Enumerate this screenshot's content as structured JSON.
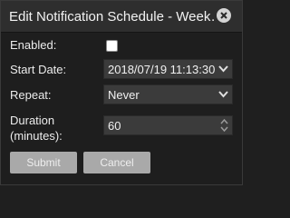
{
  "dialog": {
    "title": "Edit Notification Schedule - Week…"
  },
  "form": {
    "enabled_label": "Enabled:",
    "enabled_checked": false,
    "start_date_label": "Start Date:",
    "start_date_value": "2018/07/19 11:13:30",
    "repeat_label": "Repeat:",
    "repeat_value": "Never",
    "duration_label_line1": "Duration",
    "duration_label_line2": "(minutes):",
    "duration_value": "60"
  },
  "buttons": {
    "submit_label": "Submit",
    "cancel_label": "Cancel"
  },
  "icons": {
    "close": "close-icon",
    "chevron": "chevron-down-icon",
    "spinner": "spinner-arrows-icon"
  }
}
